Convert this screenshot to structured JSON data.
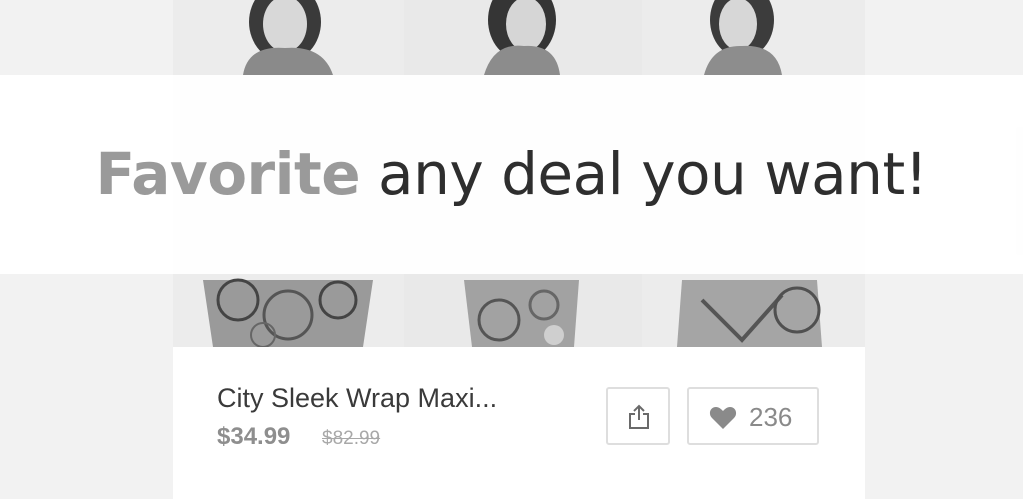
{
  "banner": {
    "headline_accent": "Favorite",
    "headline_rest": " any deal you want!"
  },
  "product": {
    "title": "City Sleek Wrap Maxi...",
    "price": "$34.99",
    "original_price": "$82.99",
    "favorites_count": "236"
  },
  "icons": {
    "share": "share-icon",
    "favorite": "heart-icon"
  },
  "colors": {
    "accent": "#9a9a9a",
    "text": "#2e2e2e",
    "price": "#8e8e8e"
  }
}
